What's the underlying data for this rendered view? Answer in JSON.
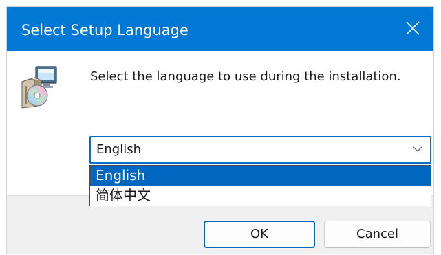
{
  "window": {
    "title": "Select Setup Language",
    "accent_color": "#0078d4",
    "close_icon": "close-icon"
  },
  "body": {
    "icon": "setup-package-icon",
    "message": "Select the language to use during the installation."
  },
  "language_select": {
    "selected_value": "English",
    "expanded": true,
    "options": [
      "English",
      "简体中文"
    ],
    "highlighted_option": "English",
    "highlight_color": "#0067c0"
  },
  "buttons": {
    "ok_label": "OK",
    "cancel_label": "Cancel"
  }
}
